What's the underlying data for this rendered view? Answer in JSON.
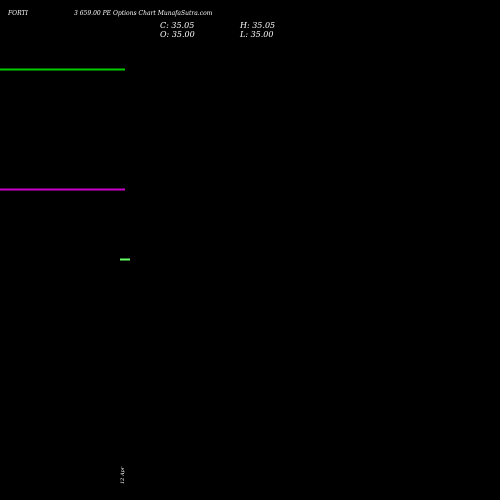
{
  "header": {
    "symbol": "FORTI",
    "subtitle": "3 659.00  PE Options  Chart MunafaSutra.com"
  },
  "ohlc": {
    "close_label": "C:",
    "close": "35.05",
    "high_label": "H:",
    "high": "35.05",
    "open_label": "O:",
    "open": "35.00",
    "low_label": "L:",
    "low": "35.00"
  },
  "colors": {
    "background": "#000000",
    "upper_line": "#00cc00",
    "lower_line": "#cc00cc",
    "candle": "#66ff66",
    "text": "#ffffff"
  },
  "chart_data": {
    "type": "line",
    "title": "",
    "xlabel": "",
    "ylabel": "",
    "x_ticks": [
      "12 Apr"
    ],
    "series": [
      {
        "color": "#00cc00",
        "style": "horizontal",
        "value": "upper"
      },
      {
        "color": "#cc00cc",
        "style": "horizontal",
        "value": "lower"
      }
    ],
    "candles": [
      {
        "date": "12 Apr",
        "open": 35.0,
        "high": 35.05,
        "low": 35.0,
        "close": 35.05
      }
    ],
    "grid": false,
    "legend": "none"
  }
}
